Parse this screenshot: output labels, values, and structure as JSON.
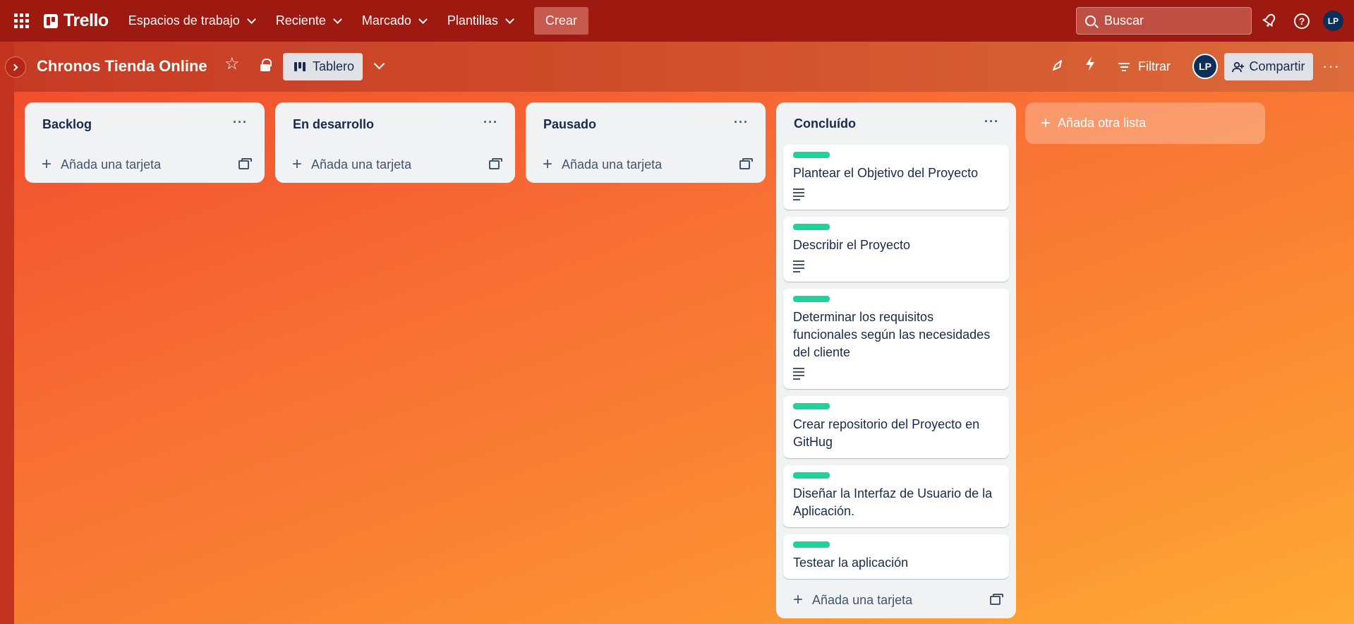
{
  "topbar": {
    "logo": "Trello",
    "nav": [
      {
        "label": "Espacios de trabajo"
      },
      {
        "label": "Reciente"
      },
      {
        "label": "Marcado"
      },
      {
        "label": "Plantillas"
      }
    ],
    "create_label": "Crear",
    "search_placeholder": "Buscar",
    "avatar_initials": "LP"
  },
  "board": {
    "title": "Chronos Tienda Online",
    "view_label": "Tablero",
    "filter_label": "Filtrar",
    "share_label": "Compartir",
    "member_initials": "LP"
  },
  "lists": [
    {
      "title": "Backlog",
      "add_label": "Añada una tarjeta",
      "cards": []
    },
    {
      "title": "En desarrollo",
      "add_label": "Añada una tarjeta",
      "cards": []
    },
    {
      "title": "Pausado",
      "add_label": "Añada una tarjeta",
      "cards": []
    },
    {
      "title": "Concluído",
      "add_label": "Añada una tarjeta",
      "cards": [
        {
          "text": "Plantear el Objetivo del Proyecto",
          "has_description": true
        },
        {
          "text": "Describir el Proyecto",
          "has_description": true
        },
        {
          "text": "Determinar los requisitos funcionales según las necesidades del cliente",
          "has_description": true
        },
        {
          "text": "Crear repositorio del Proyecto en GitHug",
          "has_description": false
        },
        {
          "text": "Diseñar la Interfaz de Usuario de la Aplicación.",
          "has_description": false
        },
        {
          "text": "Testear la aplicación",
          "has_description": false
        }
      ]
    }
  ],
  "add_list_label": "Añada otra lista",
  "colors": {
    "header": "#9e1a10",
    "label_green": "#1fd29a",
    "list_bg": "#f1f2f4"
  }
}
